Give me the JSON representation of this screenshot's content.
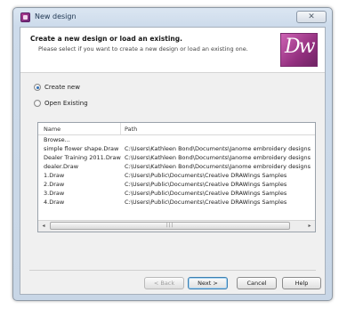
{
  "window": {
    "title": "New design",
    "close_glyph": "✕"
  },
  "header": {
    "title": "Create a new design or load an existing.",
    "subtitle": "Please select if you want to create a new design or load an existing one.",
    "logo_text": "Dw"
  },
  "options": {
    "create_new": {
      "label": "Create new",
      "selected": true
    },
    "open_existing": {
      "label": "Open Existing",
      "selected": false
    }
  },
  "list": {
    "columns": {
      "name": "Name",
      "path": "Path"
    },
    "rows": [
      {
        "name": "Browse...",
        "path": ""
      },
      {
        "name": "simple flower shape.Draw",
        "path": "C:\\Users\\Kathleen Bond\\Documents\\Janome embroidery designs"
      },
      {
        "name": "Dealer Training 2011.Draw",
        "path": "C:\\Users\\Kathleen Bond\\Documents\\Janome embroidery designs"
      },
      {
        "name": "dealer.Draw",
        "path": "C:\\Users\\Kathleen Bond\\Documents\\Janome embroidery designs"
      },
      {
        "name": "1.Draw",
        "path": "C:\\Users\\Public\\Documents\\Creative DRAWings Samples"
      },
      {
        "name": "2.Draw",
        "path": "C:\\Users\\Public\\Documents\\Creative DRAWings Samples"
      },
      {
        "name": "3.Draw",
        "path": "C:\\Users\\Public\\Documents\\Creative DRAWings Samples"
      },
      {
        "name": "4.Draw",
        "path": "C:\\Users\\Public\\Documents\\Creative DRAWings Samples"
      }
    ],
    "scroll_left_glyph": "◂",
    "scroll_right_glyph": "▸",
    "scroll_grip": "|||"
  },
  "buttons": {
    "back": "< Back",
    "next": "Next >",
    "cancel": "Cancel",
    "help": "Help"
  },
  "icons": {
    "app": "app-logo-icon",
    "close": "close-icon",
    "radio": "radio-icon"
  }
}
